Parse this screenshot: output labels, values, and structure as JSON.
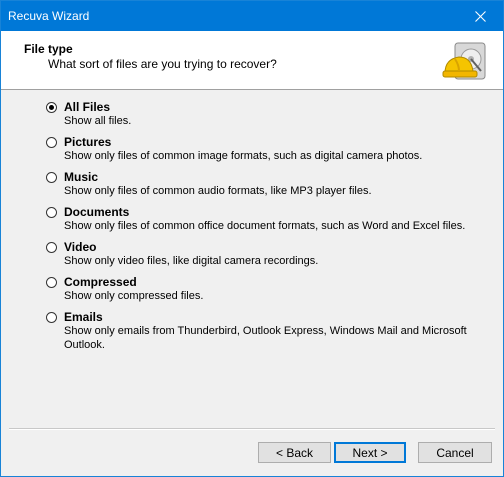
{
  "window": {
    "title": "Recuva Wizard",
    "close_glyph": "✕"
  },
  "header": {
    "title": "File type",
    "subtitle": "What sort of files are you trying to recover?",
    "logo_icon": "hard-drive-with-hardhat-icon"
  },
  "options": [
    {
      "label": "All Files",
      "description": "Show all files.",
      "checked": true
    },
    {
      "label": "Pictures",
      "description": "Show only files of common image formats, such as digital camera photos.",
      "checked": false
    },
    {
      "label": "Music",
      "description": "Show only files of common audio formats, like MP3 player files.",
      "checked": false
    },
    {
      "label": "Documents",
      "description": "Show only files of common office document formats, such as Word and Excel files.",
      "checked": false
    },
    {
      "label": "Video",
      "description": "Show only video files, like digital camera recordings.",
      "checked": false
    },
    {
      "label": "Compressed",
      "description": "Show only compressed files.",
      "checked": false
    },
    {
      "label": "Emails",
      "description": "Show only emails from Thunderbird, Outlook Express, Windows Mail and Microsoft Outlook.",
      "checked": false
    }
  ],
  "buttons": {
    "back": "< Back",
    "next": "Next >",
    "cancel": "Cancel"
  },
  "colors": {
    "titlebar": "#0078d7",
    "dialog_bg": "#f0f0f0",
    "accent": "#0078d7"
  }
}
